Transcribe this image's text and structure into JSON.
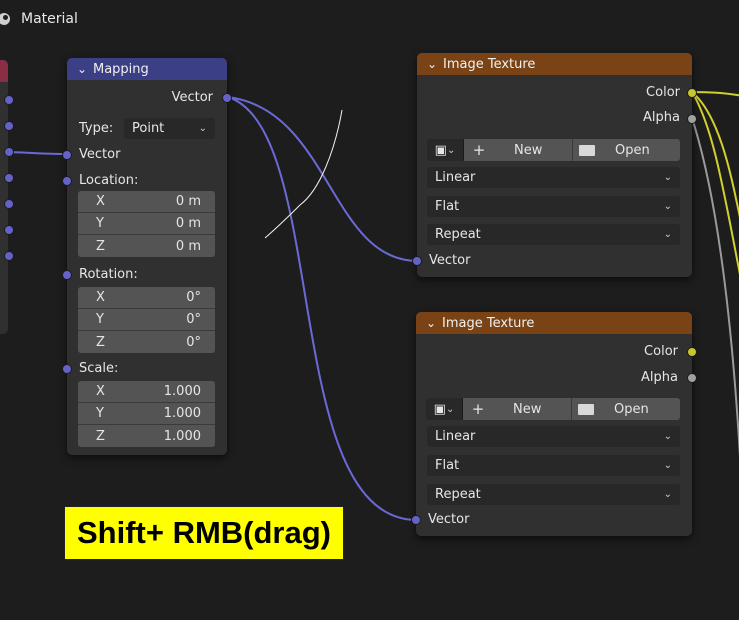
{
  "header": {
    "title": "Material",
    "icon": "material-sphere-icon"
  },
  "mapping": {
    "title": "Mapping",
    "output_socket": "Vector",
    "type_label": "Type:",
    "type_value": "Point",
    "input_vector": "Vector",
    "location_label": "Location:",
    "location": {
      "x_label": "X",
      "x": "0 m",
      "y_label": "Y",
      "y": "0 m",
      "z_label": "Z",
      "z": "0 m"
    },
    "rotation_label": "Rotation:",
    "rotation": {
      "x_label": "X",
      "x": "0°",
      "y_label": "Y",
      "y": "0°",
      "z_label": "Z",
      "z": "0°"
    },
    "scale_label": "Scale:",
    "scale": {
      "x_label": "X",
      "x": "1.000",
      "y_label": "Y",
      "y": "1.000",
      "z_label": "Z",
      "z": "1.000"
    }
  },
  "texture1": {
    "title": "Image Texture",
    "color": "Color",
    "alpha": "Alpha",
    "new_label": "New",
    "open_label": "Open",
    "interpolation": "Linear",
    "projection": "Flat",
    "extension": "Repeat",
    "vector": "Vector"
  },
  "texture2": {
    "title": "Image Texture",
    "color": "Color",
    "alpha": "Alpha",
    "new_label": "New",
    "open_label": "Open",
    "interpolation": "Linear",
    "projection": "Flat",
    "extension": "Repeat",
    "vector": "Vector"
  },
  "overlay": {
    "text": "Shift+ RMB(drag)"
  },
  "colors": {
    "background": "#1d1d1d",
    "node": "#303030",
    "mapping_header": "#3b3f86",
    "texture_header": "#7a4316",
    "vector_socket": "#6363c7",
    "color_socket": "#c7c729",
    "float_socket": "#a1a1a1",
    "overlay_bg": "#ffff00"
  }
}
